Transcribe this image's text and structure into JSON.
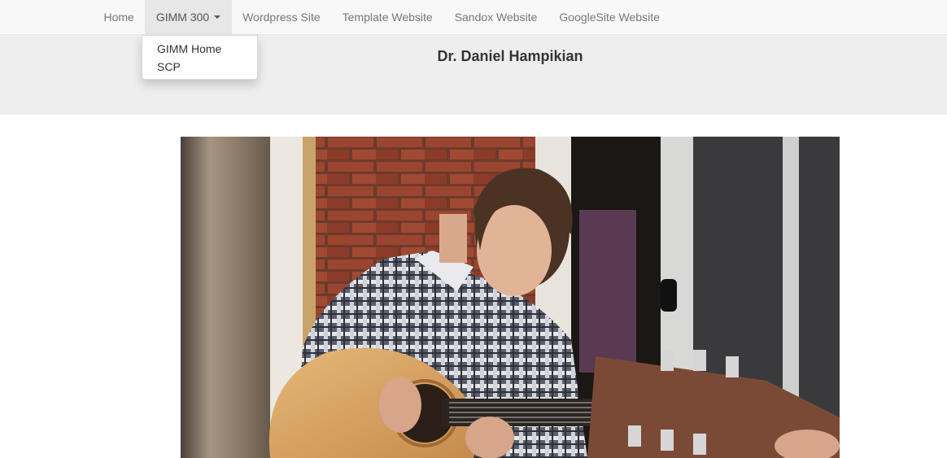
{
  "nav": {
    "items": [
      {
        "label": "Home"
      },
      {
        "label": "GIMM 300"
      },
      {
        "label": "Wordpress Site"
      },
      {
        "label": "Template Website"
      },
      {
        "label": "Sandox Website"
      },
      {
        "label": "GoogleSite Website"
      }
    ],
    "dropdown": {
      "items": [
        {
          "label": "GIMM Home"
        },
        {
          "label": "SCP"
        }
      ]
    }
  },
  "header": {
    "title": "Dr. Daniel Hampikian"
  },
  "colors": {
    "navbar_bg": "#f8f8f8",
    "nav_active_bg": "#e7e7e7",
    "jumbotron_bg": "#eeeeee",
    "brick": "#8c3a26"
  },
  "photo": {
    "icon": "photo-guitar-player"
  }
}
